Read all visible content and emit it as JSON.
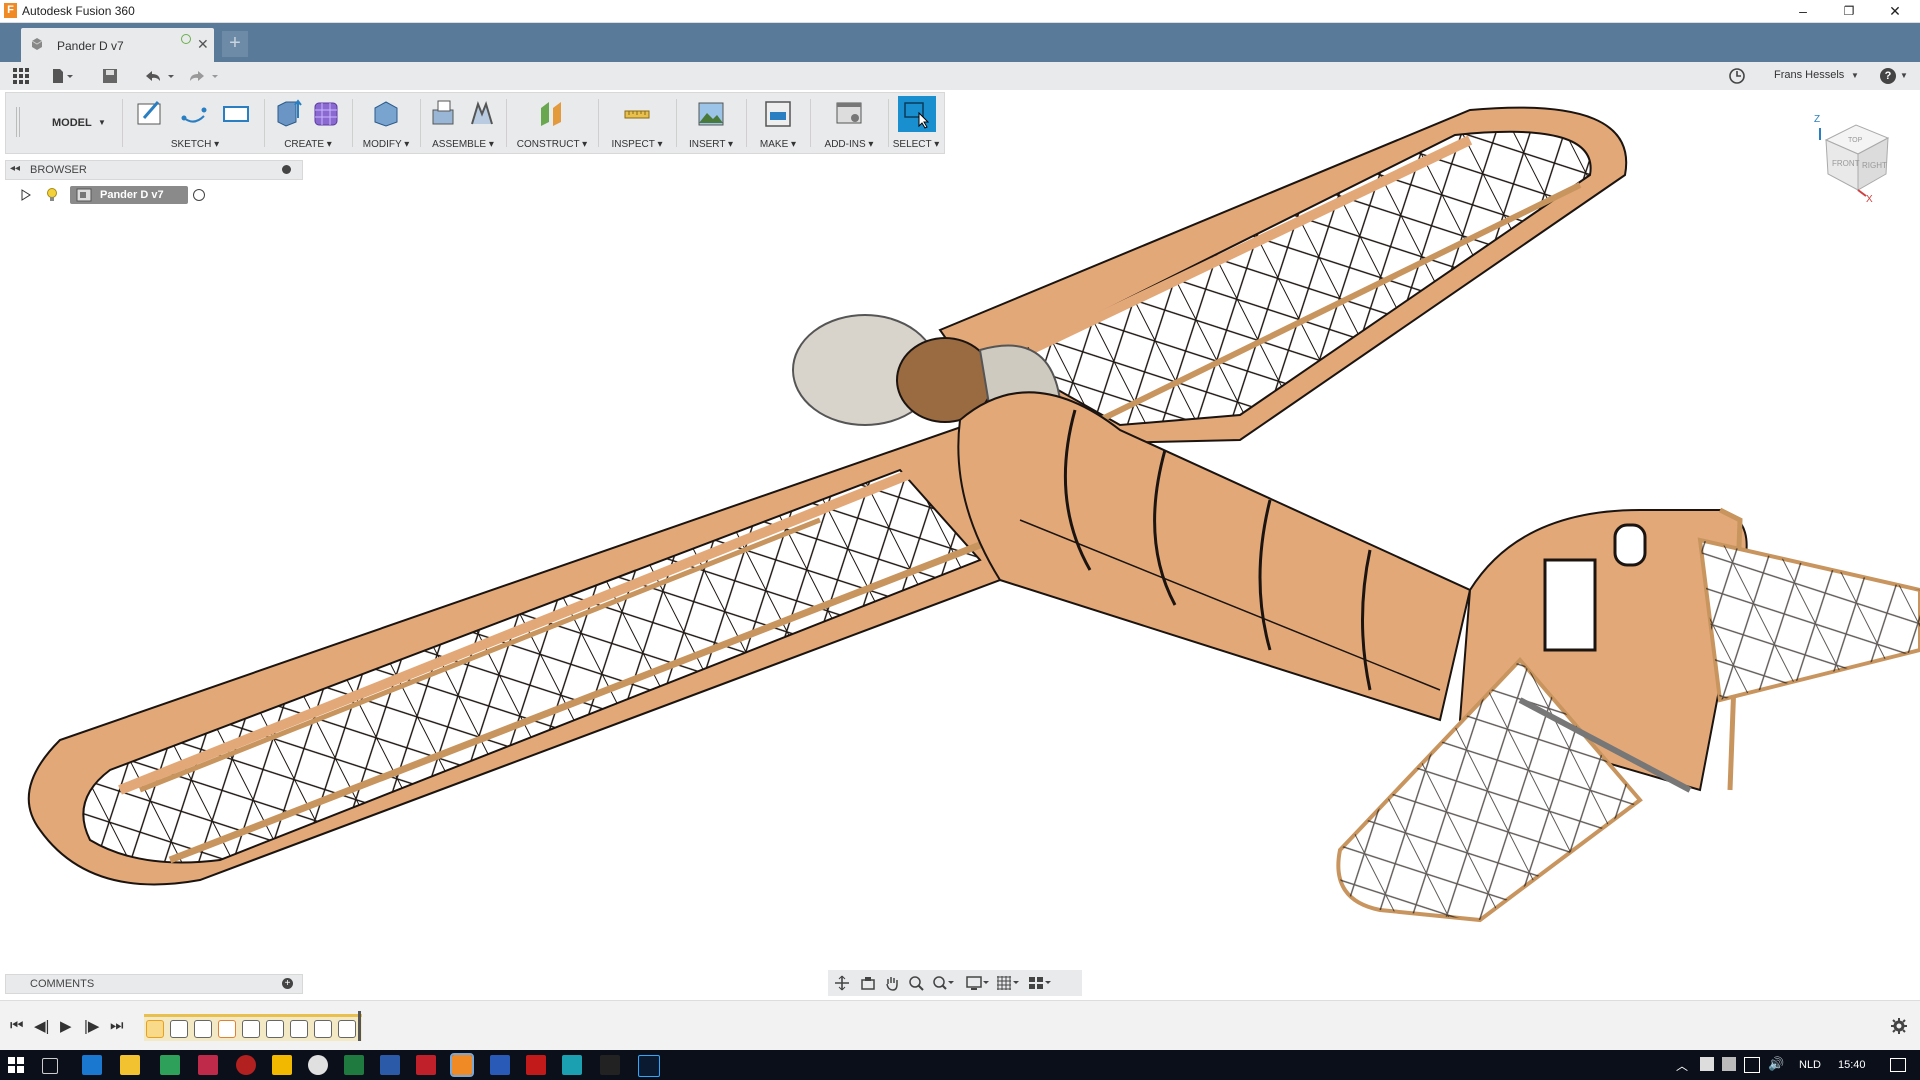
{
  "app": {
    "title": "Autodesk Fusion 360",
    "logo_letter": "F"
  },
  "window": {
    "minimize": "–",
    "restore": "❐",
    "close": "✕"
  },
  "document_tab": {
    "label": "Pander D v7",
    "close": "✕",
    "new_tab": "+"
  },
  "quick_access": {
    "user": "Frans Hessels",
    "help": "?"
  },
  "toolbar": {
    "workspace": "MODEL",
    "groups": [
      {
        "label": "SKETCH"
      },
      {
        "label": "CREATE"
      },
      {
        "label": "MODIFY"
      },
      {
        "label": "ASSEMBLE"
      },
      {
        "label": "CONSTRUCT"
      },
      {
        "label": "INSPECT"
      },
      {
        "label": "INSERT"
      },
      {
        "label": "MAKE"
      },
      {
        "label": "ADD-INS"
      },
      {
        "label": "SELECT"
      }
    ]
  },
  "browser": {
    "title": "BROWSER",
    "root_item": "Pander D v7"
  },
  "viewcube": {
    "front": "FRONT",
    "right": "RIGHT",
    "top": "TOP",
    "axis_x": "X",
    "axis_z": "Z"
  },
  "comments": {
    "title": "COMMENTS"
  },
  "taskbar": {
    "language": "NLD",
    "time": "15:40"
  },
  "colors": {
    "tab_bar": "#5a7a99",
    "wood": "#e3a878",
    "select_active": "#1a8fd0"
  }
}
